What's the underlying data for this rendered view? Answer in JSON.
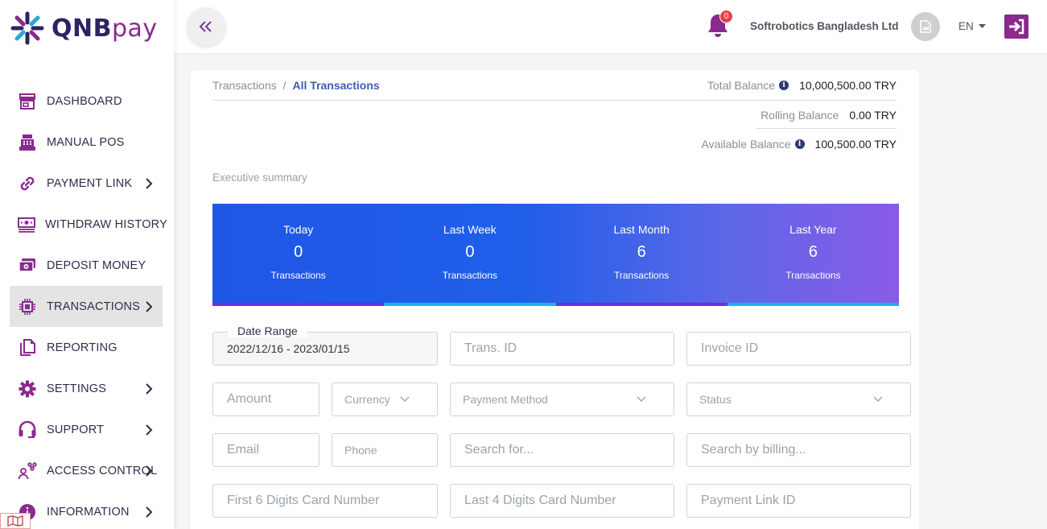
{
  "brand": {
    "name_main": "QNB",
    "name_pay": "pay"
  },
  "sidebar": {
    "items": [
      {
        "label": "DASHBOARD",
        "icon": "store-icon",
        "chevron": false,
        "active": false
      },
      {
        "label": "MANUAL POS",
        "icon": "cash-register-icon",
        "chevron": false,
        "active": false
      },
      {
        "label": "PAYMENT LINK",
        "icon": "link-icon",
        "chevron": true,
        "active": false
      },
      {
        "label": "WITHDRAW HISTORY",
        "icon": "money-bill-icon",
        "chevron": false,
        "active": false
      },
      {
        "label": "DEPOSIT MONEY",
        "icon": "money-stack-icon",
        "chevron": false,
        "active": false
      },
      {
        "label": "TRANSACTIONS",
        "icon": "chip-icon",
        "chevron": true,
        "active": true
      },
      {
        "label": "REPORTING",
        "icon": "copy-icon",
        "chevron": false,
        "active": false
      },
      {
        "label": "SETTINGS",
        "icon": "gear-icon",
        "chevron": true,
        "active": false
      },
      {
        "label": "SUPPORT",
        "icon": "headset-icon",
        "chevron": true,
        "active": false
      },
      {
        "label": "ACCESS CONTROL",
        "icon": "user-network-icon",
        "chevron": true,
        "active": false
      },
      {
        "label": "INFORMATION",
        "icon": "info-icon",
        "chevron": true,
        "active": false
      }
    ]
  },
  "header": {
    "notification_count": "0",
    "company": "Softrobotics Bangladesh Ltd",
    "language": "EN"
  },
  "breadcrumb": {
    "parent": "Transactions",
    "separator": "/",
    "current": "All Transactions"
  },
  "balances": {
    "total_label": "Total Balance",
    "total_value": "10,000,500.00 TRY",
    "rolling_label": "Rolling Balance",
    "rolling_value": "0.00 TRY",
    "available_label": "Available Balance",
    "available_value": "100,500.00 TRY"
  },
  "summary": {
    "heading": "Executive summary",
    "cards": [
      {
        "title": "Today",
        "value": "0",
        "sub": "Transactions"
      },
      {
        "title": "Last Week",
        "value": "0",
        "sub": "Transactions"
      },
      {
        "title": "Last Month",
        "value": "6",
        "sub": "Transactions"
      },
      {
        "title": "Last Year",
        "value": "6",
        "sub": "Transactions"
      }
    ]
  },
  "filters": {
    "date_range_label": "Date Range",
    "date_range_value": "2022/12/16 - 2023/01/15",
    "trans_id": "Trans. ID",
    "invoice_id": "Invoice ID",
    "amount": "Amount",
    "currency": "Currency",
    "payment_method": "Payment Method",
    "status": "Status",
    "email": "Email",
    "phone": "Phone",
    "search_for": "Search for...",
    "search_billing": "Search by billing...",
    "first6": "First 6 Digits Card Number",
    "last4": "Last 4 Digits Card Number",
    "payment_link_id": "Payment Link ID"
  },
  "colors": {
    "brand_navy": "#2b2464",
    "brand_purple": "#8a2a8f",
    "accent_blue": "#3f5bb3",
    "summary_gradient_start": "#1f56e6",
    "summary_gradient_end": "#8a5be6",
    "bar_purple": "#6a2fd6",
    "bar_cyan": "#1ab0f0"
  }
}
